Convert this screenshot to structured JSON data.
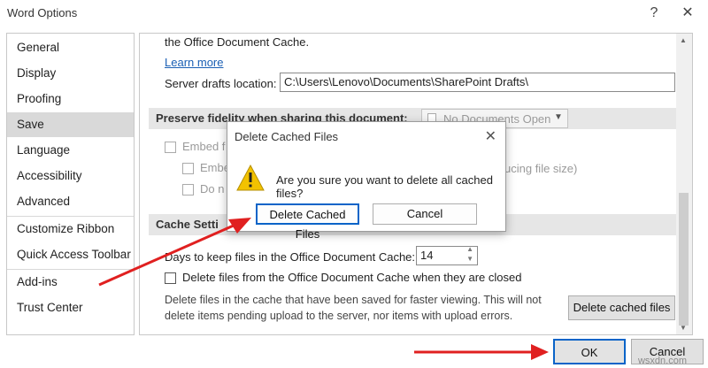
{
  "window": {
    "title": "Word Options",
    "help_glyph": "?",
    "close_glyph": "✕"
  },
  "nav": {
    "items": [
      "General",
      "Display",
      "Proofing",
      "Save",
      "Language",
      "Accessibility",
      "Advanced",
      "Customize Ribbon",
      "Quick Access Toolbar",
      "Add-ins",
      "Trust Center"
    ],
    "selected": "Save"
  },
  "content": {
    "cache_text_tail": "the Office Document Cache.",
    "learn_more": "Learn more",
    "server_drafts_label": "Server drafts location:",
    "server_drafts_value": "C:\\Users\\Lenovo\\Documents\\SharePoint Drafts\\",
    "fidelity_header": "Preserve fidelity when sharing this document:",
    "fidelity_select": "No Documents Open",
    "embed_f": "Embed f",
    "embe": "Embe",
    "do_n": "Do n",
    "ucing_file_size": "ucing file size)",
    "cache_settings_header": "Cache Setti",
    "days_label": "Days to keep files in the Office Document Cache:",
    "days_value": "14",
    "delete_on_close": "Delete files from the Office Document Cache when they are closed",
    "delete_desc_1": "Delete files in the cache that have been saved for faster viewing. This will not",
    "delete_desc_2": "delete items pending upload to the server, nor items with upload errors.",
    "delete_cached_button": "Delete cached files"
  },
  "dialog": {
    "title": "Delete Cached Files",
    "close_glyph": "✕",
    "message": "Are you sure you want to delete all cached files?",
    "confirm_button": "Delete Cached Files",
    "cancel_button": "Cancel"
  },
  "footer": {
    "ok_button": "OK",
    "cancel_button": "Cancel"
  },
  "watermark": "wsxdn.com",
  "colors": {
    "arrow": "#e02020",
    "link": "#1a5fb4",
    "selected_nav": "#d9d9d9",
    "warning": "#f2c200"
  }
}
